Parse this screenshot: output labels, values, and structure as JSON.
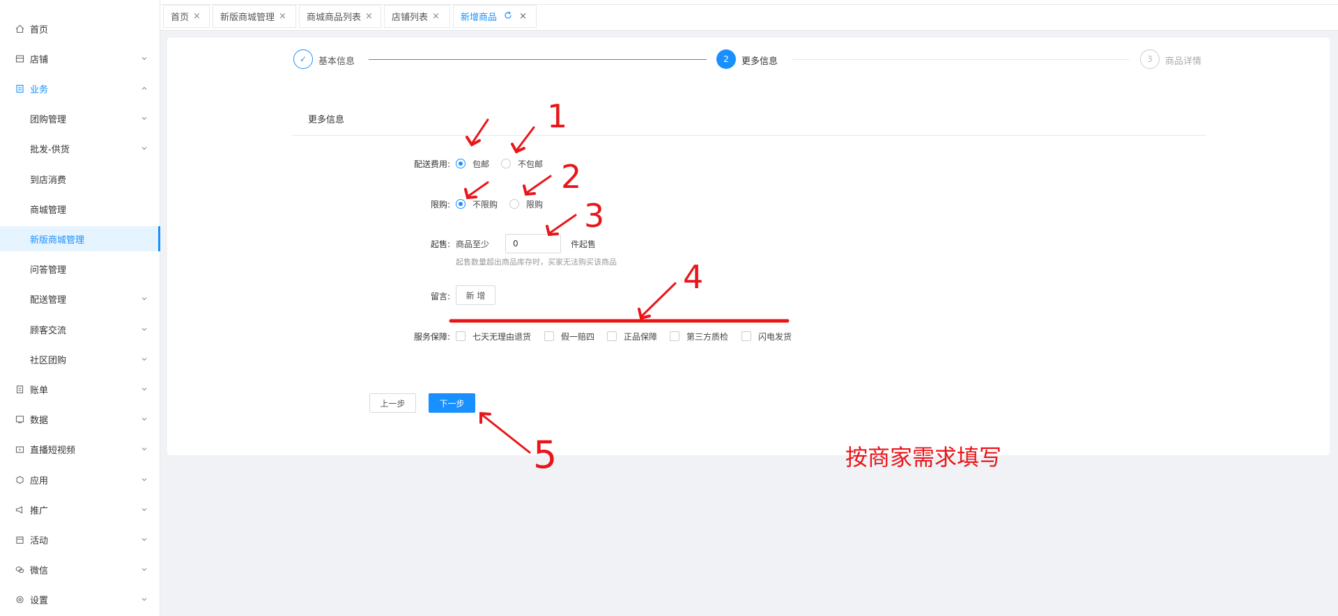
{
  "sidebar": {
    "items": [
      {
        "label": "首页",
        "icon": "home-icon",
        "has_chevron": false
      },
      {
        "label": "店铺",
        "icon": "store-icon",
        "has_chevron": true,
        "chevron": "down"
      },
      {
        "label": "业务",
        "icon": "business-icon",
        "has_chevron": true,
        "chevron": "up",
        "expanded": true
      },
      {
        "label": "团购管理",
        "sub": true,
        "has_chevron": true,
        "chevron": "down"
      },
      {
        "label": "批发-供货",
        "sub": true,
        "has_chevron": true,
        "chevron": "down"
      },
      {
        "label": "到店消费",
        "sub": true,
        "has_chevron": false
      },
      {
        "label": "商城管理",
        "sub": true,
        "has_chevron": false
      },
      {
        "label": "新版商城管理",
        "sub": true,
        "has_chevron": false,
        "selected": true
      },
      {
        "label": "问答管理",
        "sub": true,
        "has_chevron": false
      },
      {
        "label": "配送管理",
        "sub": true,
        "has_chevron": true,
        "chevron": "down"
      },
      {
        "label": "顾客交流",
        "sub": true,
        "has_chevron": true,
        "chevron": "down"
      },
      {
        "label": "社区团购",
        "sub": true,
        "has_chevron": true,
        "chevron": "down"
      },
      {
        "label": "账单",
        "icon": "bill-icon",
        "has_chevron": true,
        "chevron": "down"
      },
      {
        "label": "数据",
        "icon": "data-icon",
        "has_chevron": true,
        "chevron": "down"
      },
      {
        "label": "直播短视频",
        "icon": "video-icon",
        "has_chevron": true,
        "chevron": "down"
      },
      {
        "label": "应用",
        "icon": "app-icon",
        "has_chevron": true,
        "chevron": "down"
      },
      {
        "label": "推广",
        "icon": "promote-icon",
        "has_chevron": true,
        "chevron": "down"
      },
      {
        "label": "活动",
        "icon": "activity-icon",
        "has_chevron": true,
        "chevron": "down"
      },
      {
        "label": "微信",
        "icon": "wechat-icon",
        "has_chevron": true,
        "chevron": "down"
      },
      {
        "label": "设置",
        "icon": "settings-icon",
        "has_chevron": true,
        "chevron": "down"
      }
    ]
  },
  "tabs": [
    {
      "label": "首页",
      "close": "×"
    },
    {
      "label": "新版商城管理",
      "close": "×"
    },
    {
      "label": "商城商品列表",
      "close": "×"
    },
    {
      "label": "店铺列表",
      "close": "×"
    },
    {
      "label": "新增商品",
      "close": "×",
      "active": true
    }
  ],
  "steps": [
    {
      "label": "基本信息",
      "state": "done",
      "marker": "✓"
    },
    {
      "label": "更多信息",
      "state": "current",
      "marker": "2"
    },
    {
      "label": "商品详情",
      "state": "pending",
      "marker": "3"
    }
  ],
  "section_title": "更多信息",
  "form": {
    "shipping": {
      "label": "配送费用:",
      "options": [
        "包邮",
        "不包邮"
      ],
      "selected": 0
    },
    "limit": {
      "label": "限购:",
      "options": [
        "不限购",
        "限购"
      ],
      "selected": 0
    },
    "min_sale": {
      "label": "起售:",
      "prefix": "商品至少",
      "value": "0",
      "suffix": "件起售",
      "hint": "起售数量超出商品库存时，买家无法购买该商品"
    },
    "message": {
      "label": "留言:",
      "button": "新 增"
    },
    "service": {
      "label": "服务保障:",
      "options": [
        "七天无理由退货",
        "假一赔四",
        "正品保障",
        "第三方质检",
        "闪电发货"
      ]
    }
  },
  "buttons": {
    "prev": "上一步",
    "next": "下一步"
  },
  "annotations": {
    "numbers": [
      "1",
      "2",
      "3",
      "4",
      "5"
    ],
    "note": "按商家需求填写",
    "color": "#e8161a"
  },
  "colors": {
    "accent": "#1890ff",
    "annotation": "#e8161a"
  }
}
